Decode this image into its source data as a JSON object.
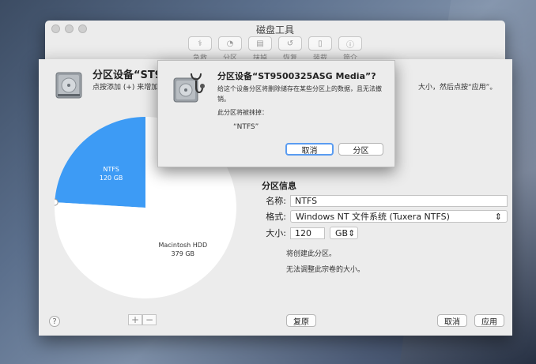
{
  "window": {
    "title": "磁盘工具",
    "toolbar": [
      {
        "label": "急救",
        "icon": "stethoscope-icon"
      },
      {
        "label": "分区",
        "icon": "partition-icon"
      },
      {
        "label": "抹掉",
        "icon": "erase-icon"
      },
      {
        "label": "恢复",
        "icon": "restore-icon"
      },
      {
        "label": "装载",
        "icon": "mount-icon"
      },
      {
        "label": "简介",
        "icon": "info-icon"
      }
    ]
  },
  "sheet": {
    "title": "分区设备“ST95003",
    "description": "点按添加 (+) 来增加设备",
    "description_right": "大小，然后点按“应用”。",
    "pie": {
      "slices": [
        {
          "name": "NTFS",
          "size": "120 GB",
          "value": 120,
          "color": "#3d9bf5"
        },
        {
          "name": "Macintosh HDD",
          "size": "379 GB",
          "value": 379,
          "color": "#ffffff"
        }
      ]
    },
    "partition_info": {
      "title": "分区信息",
      "name_label": "名称:",
      "name_value": "NTFS",
      "format_label": "格式:",
      "format_value": "Windows NT 文件系统 (Tuxera NTFS)",
      "size_label": "大小:",
      "size_value": "120",
      "size_unit": "GB",
      "note_create": "将创建此分区。",
      "note_resize": "无法调整此宗卷的大小。"
    },
    "help_label": "?",
    "add_label": "+",
    "remove_label": "−",
    "revert_label": "复原",
    "cancel_label": "取消",
    "apply_label": "应用"
  },
  "dialog": {
    "title": "分区设备“ST9500325ASG Media”?",
    "message": "给这个设备分区将删除储存在某些分区上的数据，且无法撤销。",
    "erase_label": "此分区将被抹掉：",
    "partition_name": "“NTFS”",
    "cancel_label": "取消",
    "ok_label": "分区"
  }
}
